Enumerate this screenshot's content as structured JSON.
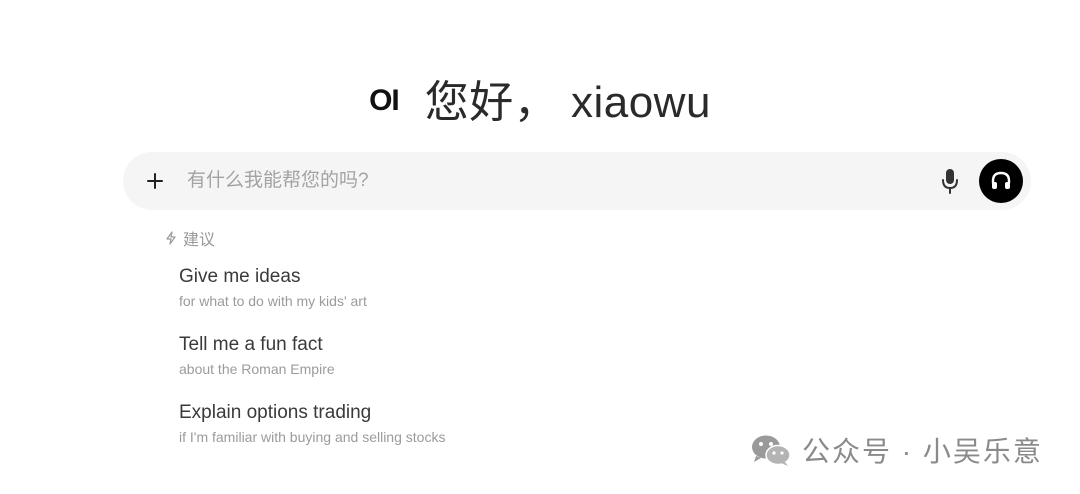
{
  "greeting": {
    "logo": "OI",
    "text": "您好， xiaowu"
  },
  "chat_input": {
    "placeholder": "有什么我能帮您的吗?",
    "value": "",
    "icons": {
      "plus": "plus-icon",
      "mic": "microphone-icon",
      "voice": "headphones-icon"
    }
  },
  "suggestions": {
    "header": "建议",
    "header_icon": "lightning-bolt-icon",
    "items": [
      {
        "title": "Give me ideas",
        "subtitle": "for what to do with my kids' art"
      },
      {
        "title": "Tell me a fun fact",
        "subtitle": "about the Roman Empire"
      },
      {
        "title": "Explain options trading",
        "subtitle": "if I'm familiar with buying and selling stocks"
      }
    ]
  },
  "watermark": {
    "text": "公众号 · 小吴乐意",
    "icon": "wechat-icon"
  },
  "colors": {
    "background": "#ffffff",
    "input_bg": "#f5f5f5",
    "voice_button_bg": "#000000",
    "placeholder": "#a3a3a3",
    "muted_text": "#9b9b9b"
  }
}
